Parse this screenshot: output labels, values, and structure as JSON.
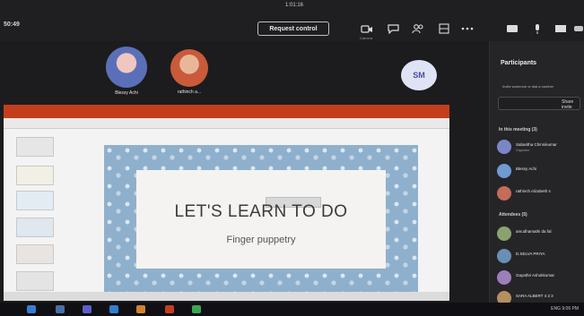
{
  "meeting": {
    "timer": "1:01:16",
    "title": "50:49",
    "request_control_label": "Request control"
  },
  "toolbar": {
    "camera": {
      "icon": "camera-icon",
      "label": "Camera"
    },
    "chat": {
      "icon": "chat-icon"
    },
    "people": {
      "icon": "people-icon"
    },
    "view": {
      "icon": "view-icon"
    },
    "more": {
      "icon": "more-icon"
    },
    "share": {
      "icon": "share-icon"
    },
    "mic": {
      "icon": "mic-icon"
    },
    "screen": {
      "icon": "screen-icon"
    }
  },
  "participants_strip": [
    {
      "name": "Blessy Achi",
      "icon": "avatar",
      "color": "#5b6fb8"
    },
    {
      "name": "rathinch a...",
      "icon": "avatar",
      "color": "#c95a3a"
    }
  ],
  "self_avatar_initials": "SM",
  "slide": {
    "title": "LET'S LEARN TO DO",
    "subtitle": "Finger puppetry"
  },
  "panel": {
    "title": "Participants",
    "hint": "Invite someone or dial a number",
    "search_button": "Share invite",
    "in_meeting_label": "In this meeting (3)",
    "attendees_label": "Attendees (5)",
    "in_meeting": [
      {
        "name": "Sabaritha Chinnikumar",
        "sub": "Organizer",
        "color": "#7b86c6"
      },
      {
        "name": "Blessy Achi",
        "sub": "",
        "color": "#6f9bd1"
      },
      {
        "name": "rathinch elizabeth s",
        "sub": "",
        "color": "#c46b5a"
      }
    ],
    "attendees": [
      {
        "name": "amudhamathi da fal",
        "sub": "",
        "color": "#8aa36e"
      },
      {
        "name": "D.SELVA PRIYA ",
        "sub": "",
        "color": "#6a8fb5"
      },
      {
        "name": "Gayathri Ashokkumar",
        "sub": "",
        "color": "#9c7fb8"
      },
      {
        "name": "SARA ALBERT 4 3 3",
        "sub": "",
        "color": "#b58f5e"
      }
    ]
  },
  "taskbar": {
    "tray_text": "ENG  9:06 PM"
  }
}
